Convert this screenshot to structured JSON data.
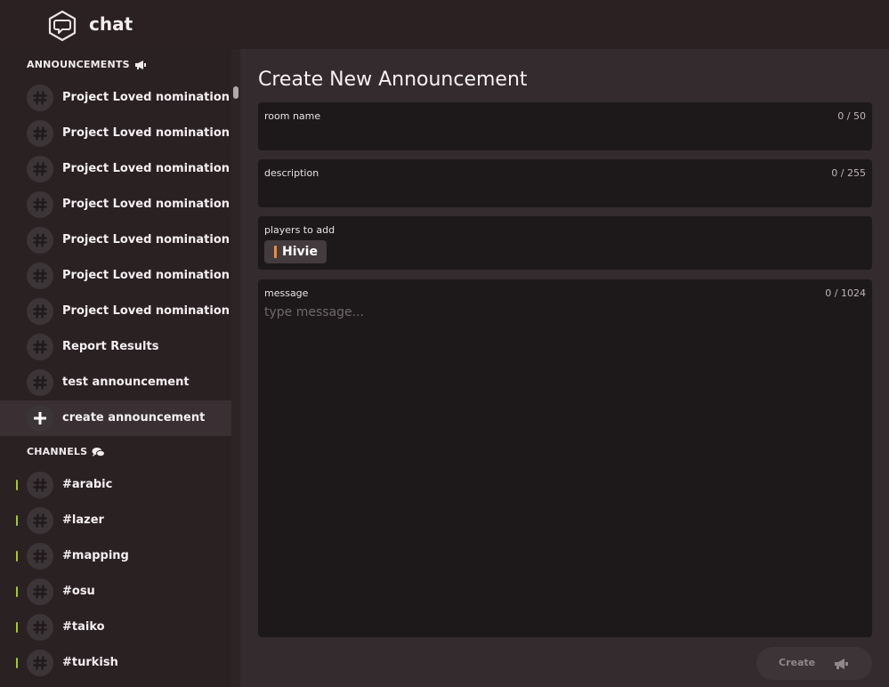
{
  "header": {
    "title": "chat",
    "logo_icon": "chat-bubble-icon"
  },
  "sidebar": {
    "announcements_header": "ANNOUNCEMENTS",
    "announcements_icon": "megaphone-icon",
    "announcements": [
      {
        "label": "Project Loved nomination"
      },
      {
        "label": "Project Loved nomination"
      },
      {
        "label": "Project Loved nomination"
      },
      {
        "label": "Project Loved nomination"
      },
      {
        "label": "Project Loved nomination"
      },
      {
        "label": "Project Loved nomination"
      },
      {
        "label": "Project Loved nomination"
      },
      {
        "label": "Report Results"
      },
      {
        "label": "test announcement"
      }
    ],
    "create_announcement": "create announcement",
    "channels_header": "CHANNELS",
    "channels_icon": "chat-bubbles-icon",
    "channels": [
      {
        "label": "#arabic"
      },
      {
        "label": "#lazer"
      },
      {
        "label": "#mapping"
      },
      {
        "label": "#osu"
      },
      {
        "label": "#taiko"
      },
      {
        "label": "#turkish"
      }
    ]
  },
  "main": {
    "title": "Create New Announcement",
    "room_name": {
      "label": "room name",
      "counter": "0 / 50",
      "value": ""
    },
    "description": {
      "label": "description",
      "counter": "0 / 255",
      "value": ""
    },
    "players": {
      "label": "players to add",
      "chips": [
        "Hivie"
      ]
    },
    "message": {
      "label": "message",
      "counter": "0 / 1024",
      "placeholder": "type message..."
    },
    "create_button": "Create"
  },
  "colors": {
    "channel_marker": "#a3cc1e",
    "player_chip_bar": "#e28e4a"
  }
}
